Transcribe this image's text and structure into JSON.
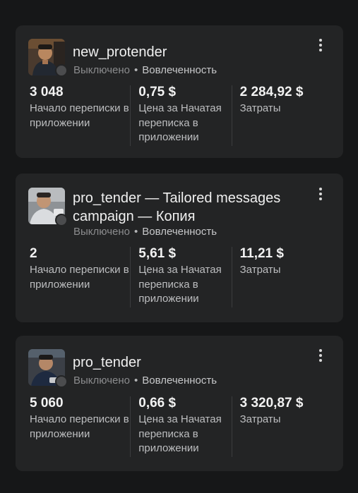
{
  "campaigns": [
    {
      "name": "new_protender",
      "status": "Выключено",
      "separator": "•",
      "goal": "Вовлеченность",
      "metrics": [
        {
          "value": "3 048",
          "label": "Начало переписки в приложении"
        },
        {
          "value": "0,75 $",
          "label": "Цена за Начатая переписка в приложении"
        },
        {
          "value": "2 284,92 $",
          "label": "Затраты"
        }
      ]
    },
    {
      "name": "pro_tender — Tailored messages campaign — Копия",
      "status": "Выключено",
      "separator": "•",
      "goal": "Вовлеченность",
      "metrics": [
        {
          "value": "2",
          "label": "Начало переписки в приложении"
        },
        {
          "value": "5,61 $",
          "label": "Цена за Начатая переписка в приложении"
        },
        {
          "value": "11,21 $",
          "label": "Затраты"
        }
      ]
    },
    {
      "name": "pro_tender",
      "status": "Выключено",
      "separator": "•",
      "goal": "Вовлеченность",
      "metrics": [
        {
          "value": "5 060",
          "label": "Начало переписки в приложении"
        },
        {
          "value": "0,66 $",
          "label": "Цена за Начатая переписка в приложении"
        },
        {
          "value": "3 320,87 $",
          "label": "Затраты"
        }
      ]
    }
  ],
  "icons": {
    "menu": "more-vertical-icon",
    "status": "status-off-dot-icon"
  },
  "colors": {
    "background": "#161718",
    "card": "#232425",
    "status_off": "#8b8c8e"
  }
}
